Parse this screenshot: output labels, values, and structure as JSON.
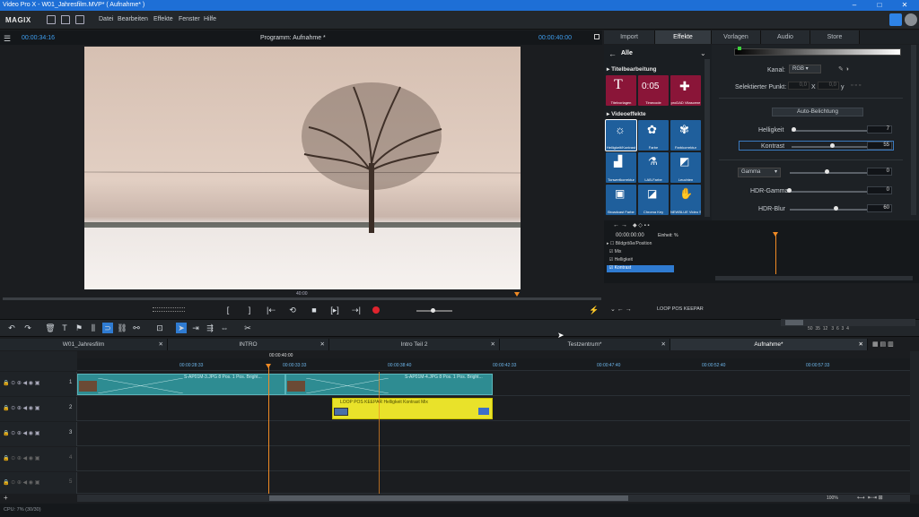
{
  "window": {
    "title": "Video Pro X - W01_Jahresfilm.MVP* ( Aufnahme* )"
  },
  "app": {
    "brand": "MAGIX"
  },
  "menu": [
    "Datei",
    "Bearbeiten",
    "Effekte",
    "Fenster",
    "Hilfe"
  ],
  "preview": {
    "timecode_left": "00:00:34:16",
    "title": "Programm: Aufnahme *",
    "timecode_right": "00:00:40:00",
    "scrub_label": "40:00"
  },
  "effects_panel": {
    "tabs": [
      "Import",
      "Effekte",
      "Vorlagen",
      "Audio",
      "Store"
    ],
    "nav_label": "Alle",
    "section_title": "Titelbearbeitung",
    "title_tiles": [
      "Titelvorlagen",
      "Timecode",
      "proDAD Vitascene"
    ],
    "section_video": "Videoeffekte",
    "video_tiles": [
      "Helligkeit/Kontrast",
      "Farbe",
      "Farbkorrektur",
      "Tonwertkorrektur",
      "LAB-Farbe",
      "Leuchten",
      "Broadcast Farbe",
      "Chroma Key",
      "NEWBLUE Video Stabilizer"
    ]
  },
  "properties": {
    "channel_label": "Kanal:",
    "channel_value": "RGB",
    "point_label": "Selektierter Punkt:",
    "point_x": "0,0",
    "point_x_label": "X",
    "point_y": "0,0",
    "point_y_label": "y",
    "auto_button": "Auto-Belichtung",
    "brightness_label": "Helligkeit",
    "brightness_value": "7",
    "contrast_label": "Kontrast",
    "contrast_value": "55",
    "gamma_label": "Gamma",
    "gamma_value": "0",
    "hdr_gamma_label": "HDR-Gamma",
    "hdr_gamma_value": "0",
    "hdr_blur_label": "HDR-Blur",
    "hdr_blur_value": "60"
  },
  "keyframes": {
    "time": "00:00:00:00",
    "unit_label": "Einheit: %",
    "rows": [
      "Bildgröße/Position",
      "Mix",
      "Helligkeit",
      "Kontrast"
    ],
    "footer": "LOOP POS KEEPAR"
  },
  "project_tabs": [
    "W01_Jahresfilm",
    "INTRO",
    "Intro Teil 2",
    "Testzentrum*",
    "Aufnahme*"
  ],
  "timeline": {
    "position": "00:00:40:00",
    "ruler_marks": [
      "00:00:28:33",
      "00:00:33:33",
      "00:00:38:40",
      "00:00:42:33",
      "00:00:47:40",
      "00:00:52:40",
      "00:00:57:33"
    ],
    "clip_top_label": "S-AP01M-3.JPG  8 Pos.  1 Pos.  Bright...",
    "clip_top_label2": "S-AP01M-4.JPG  8 Pos.  1 Pos.  Bright...",
    "clip_yellow_label": "LOOP POS KEEPAR  Helligkeit  Kontrast  Mix",
    "zoom_numbers": [
      "50",
      "35",
      "12",
      "3",
      "6",
      "3",
      "4"
    ],
    "zoom": "100%"
  },
  "status": {
    "cpu": "CPU: 7% (30/30)"
  },
  "colors": {
    "accent": "#1e6fd6",
    "playhead": "#f08a24",
    "clip": "#2e8c92",
    "clip_yellow": "#e9e22a",
    "tile_red": "#8a1538",
    "tile_blue": "#1f5f9c",
    "record": "#e0242e"
  }
}
